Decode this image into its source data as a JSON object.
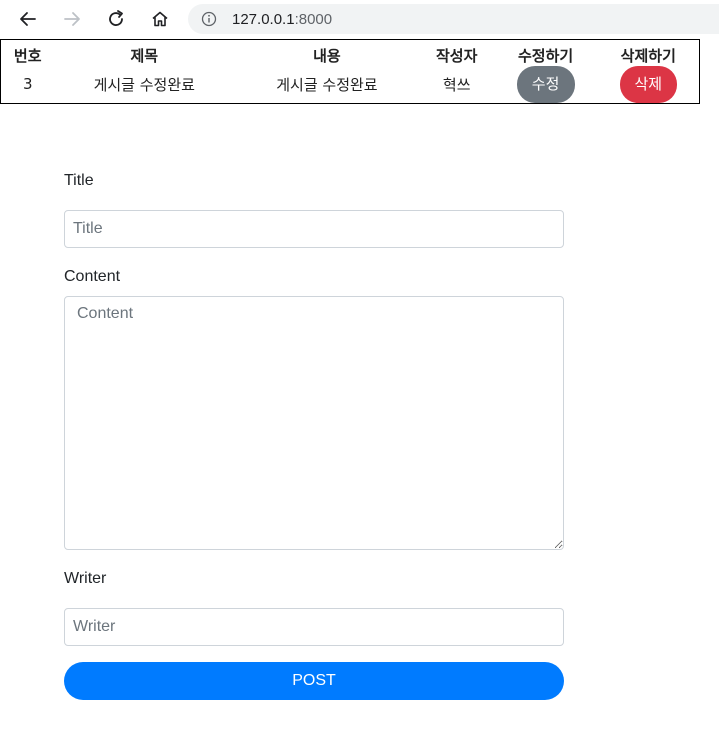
{
  "browser": {
    "url_host": "127.0.0.1",
    "url_port": ":8000",
    "icons": [
      "back-arrow-icon",
      "forward-arrow-icon",
      "reload-icon",
      "home-icon",
      "info-icon"
    ]
  },
  "table": {
    "headers": [
      "번호",
      "제목",
      "내용",
      "작성자",
      "수정하기",
      "삭제하기"
    ],
    "rows": [
      {
        "no": "3",
        "title": "게시글 수정완료",
        "content": "게시글 수정완료",
        "writer": "혁쓰",
        "edit_label": "수정",
        "delete_label": "삭제"
      }
    ]
  },
  "form": {
    "title_label": "Title",
    "title_placeholder": "Title",
    "content_label": "Content",
    "content_placeholder": "Content",
    "writer_label": "Writer",
    "writer_placeholder": "Writer",
    "submit_label": "POST"
  },
  "colors": {
    "edit_button": "#6c757d",
    "delete_button": "#dc3545",
    "post_button": "#007bff"
  }
}
